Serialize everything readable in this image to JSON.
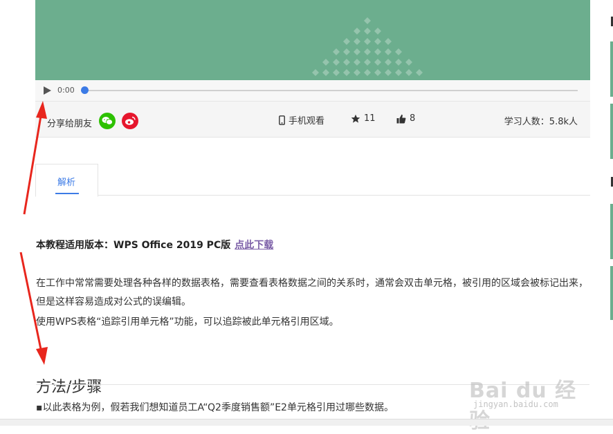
{
  "player": {
    "time": "0:00",
    "progress_fraction": 0.0
  },
  "info_bar": {
    "share_label": "分享给朋友",
    "mobile_view_label": "手机观看",
    "favorites_count": "11",
    "likes_count": "8",
    "learners_label": "学习人数：5.8k人"
  },
  "tabs": [
    {
      "label": "解析",
      "active": true
    }
  ],
  "article": {
    "version_prefix": "本教程适用版本：WPS Office 2019 PC版",
    "download_link": "点此下载",
    "paragraph_1": "在工作中常常需要处理各种各样的数据表格，需要查看表格数据之间的关系时，通常会双击单元格，被引用的区域会被标记出来，但是这样容易造成对公式的误编辑。",
    "paragraph_2": "使用WPS表格“追踪引用单元格”功能，可以追踪被此单元格引用区域。",
    "section_title": "方法/步骤",
    "step_1": "▪以此表格为例，假若我们想知道员工A“Q2季度销售额”E2单元格引用过哪些数据。"
  },
  "watermark": {
    "brand": "Bai du 经验",
    "url": "jingyan.baidu.com"
  },
  "colors": {
    "video_bg": "#6cae8e",
    "accent_blue": "#3c7be6",
    "link_purple": "#7b5ea7",
    "wechat_green": "#2dc100",
    "weibo_red": "#e6162d",
    "annotation_red": "#e8261d"
  }
}
